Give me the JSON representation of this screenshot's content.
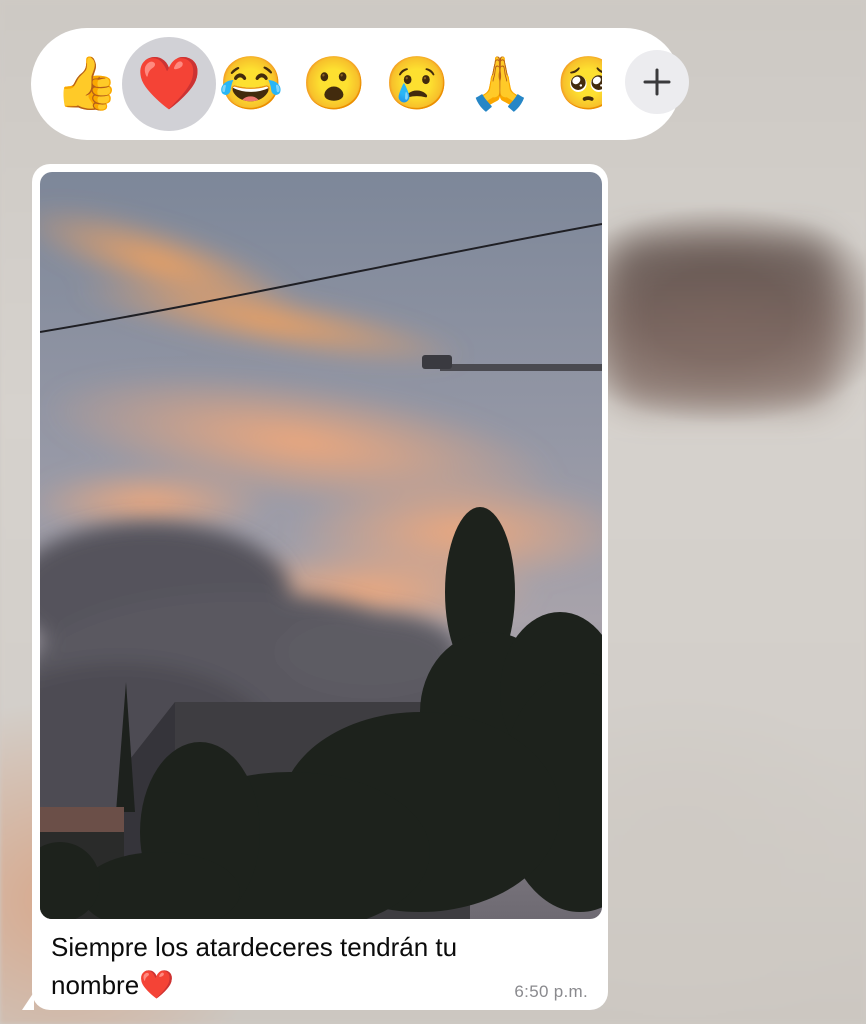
{
  "reactions": [
    {
      "emoji": "👍",
      "name": "thumbs-up-icon",
      "selected": false
    },
    {
      "emoji": "❤️",
      "name": "red-heart-icon",
      "selected": true
    },
    {
      "emoji": "😂",
      "name": "tears-of-joy-icon",
      "selected": false
    },
    {
      "emoji": "😮",
      "name": "surprised-face-icon",
      "selected": false
    },
    {
      "emoji": "😢",
      "name": "crying-face-icon",
      "selected": false
    },
    {
      "emoji": "🙏",
      "name": "folded-hands-icon",
      "selected": false
    },
    {
      "emoji": "🥺",
      "name": "pleading-face-icon",
      "selected": false
    }
  ],
  "add_reaction_icon": "plus-icon",
  "message": {
    "caption_text": "Siempre los atardeceres tendrán tu nombre",
    "caption_emoji": "❤️",
    "time": "6:50 p.m.",
    "photo": "sunset-photo"
  },
  "colors": {
    "bubble": "#ffffff",
    "selected_reaction_bg": "#d1d1d6",
    "timestamp": "#8a8a8e"
  }
}
